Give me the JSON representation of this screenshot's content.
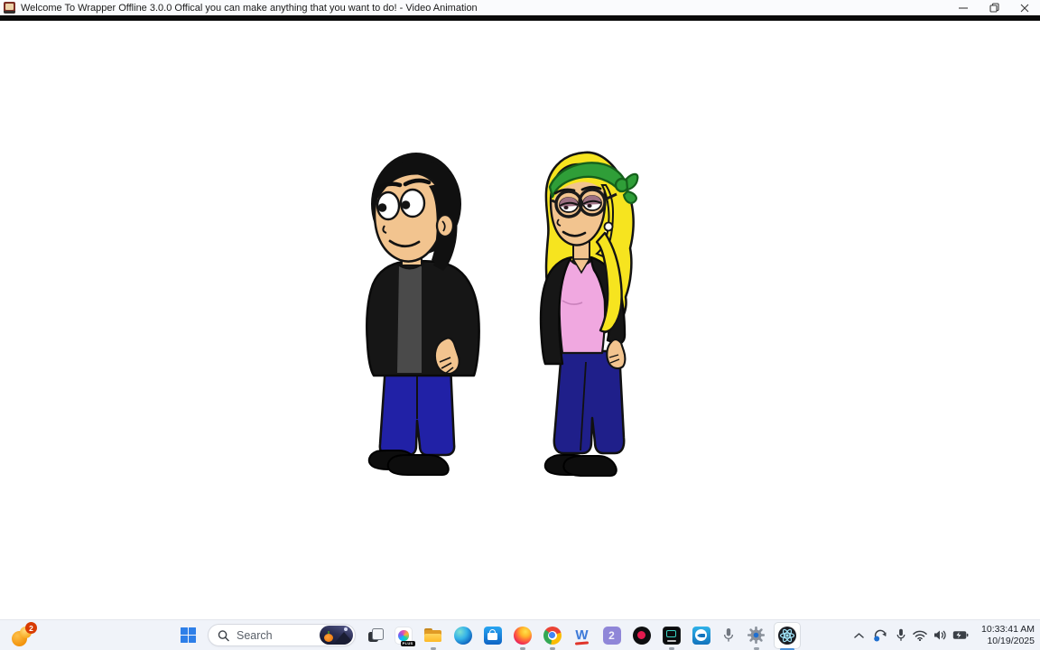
{
  "window": {
    "title": "Welcome To Wrapper Offline 3.0.0 Offical you can make anything that you want to do! - Video Animation",
    "app_icon": "wrapper-offline-app-icon"
  },
  "stage": {
    "background": "#FFFFFF",
    "characters": [
      {
        "name": "boy-character",
        "description": "Cartoon boy with black hair, black jacket over gray shirt, dark blue pants, black shoes, looking left",
        "colors": {
          "skin": "#F2C48F",
          "hair": "#101010",
          "jacket": "#161616",
          "shirt": "#4A4A4A",
          "pants": "#2121A6",
          "shoes": "#0D0D0D"
        }
      },
      {
        "name": "girl-character",
        "description": "Cartoon girl with blonde hair, green bandana, round glasses, black jacket over pink top, dark blue pants, black shoes, looking left",
        "colors": {
          "skin": "#F2C48F",
          "hair": "#F6E41F",
          "bandana": "#2F9E38",
          "jacket": "#161616",
          "top": "#F0A8E0",
          "pants": "#1F1F8A",
          "shoes": "#0D0D0D",
          "eyeshadow": "#9C7083"
        }
      }
    ]
  },
  "taskbar": {
    "widgets": {
      "badge": "2",
      "icon": "weather-sun-icon"
    },
    "search": {
      "placeholder": "Search",
      "icon": "search-icon",
      "thumbnail": "halloween-pumpkin-daily-image"
    },
    "copilot": {
      "badge": "PLUS"
    },
    "wrapper_w": {
      "letter": "W"
    },
    "app_two": {
      "label": "2"
    },
    "pinned_apps": [
      "widgets",
      "start",
      "search",
      "task-view",
      "copilot",
      "file-explorer",
      "edge",
      "microsoft-store",
      "firefox",
      "chrome",
      "goanimate-w",
      "app-2",
      "record",
      "screen-recorder",
      "video-capture",
      "microphone",
      "settings",
      "electron-wrapper"
    ],
    "running_indicator_apps": [
      "file-explorer",
      "firefox",
      "chrome",
      "screen-recorder",
      "settings"
    ],
    "active_app": "electron-wrapper",
    "clock": {
      "time": "10:33:41 AM",
      "date": "10/19/2025"
    }
  },
  "colors": {
    "taskbar_bg": "#F0F3F9",
    "accent_blue": "#2E7FE8",
    "active_underline": "#4A90D9",
    "badge_red": "#D83B01"
  }
}
